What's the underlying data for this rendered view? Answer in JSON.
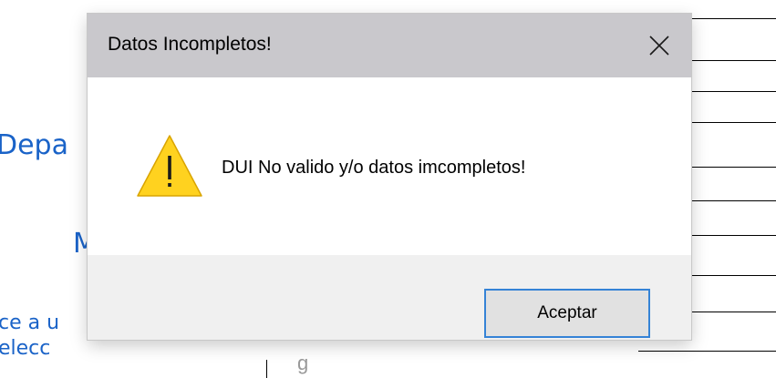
{
  "background": {
    "labels": {
      "depa": "Depa",
      "m": "M",
      "line1": "ce a u",
      "line2": "elecc"
    },
    "partial_text": "g"
  },
  "dialog": {
    "title": "Datos Incompletos!",
    "close_glyph": "✕",
    "message": "DUI No valido y/o datos imcompletos!",
    "icon": "warning-icon",
    "ok_label": "Aceptar",
    "colors": {
      "titlebar": "#c9c8cc",
      "footer": "#f0f0f0",
      "button_border": "#3583d6",
      "warning_fill": "#ffd21f"
    }
  }
}
